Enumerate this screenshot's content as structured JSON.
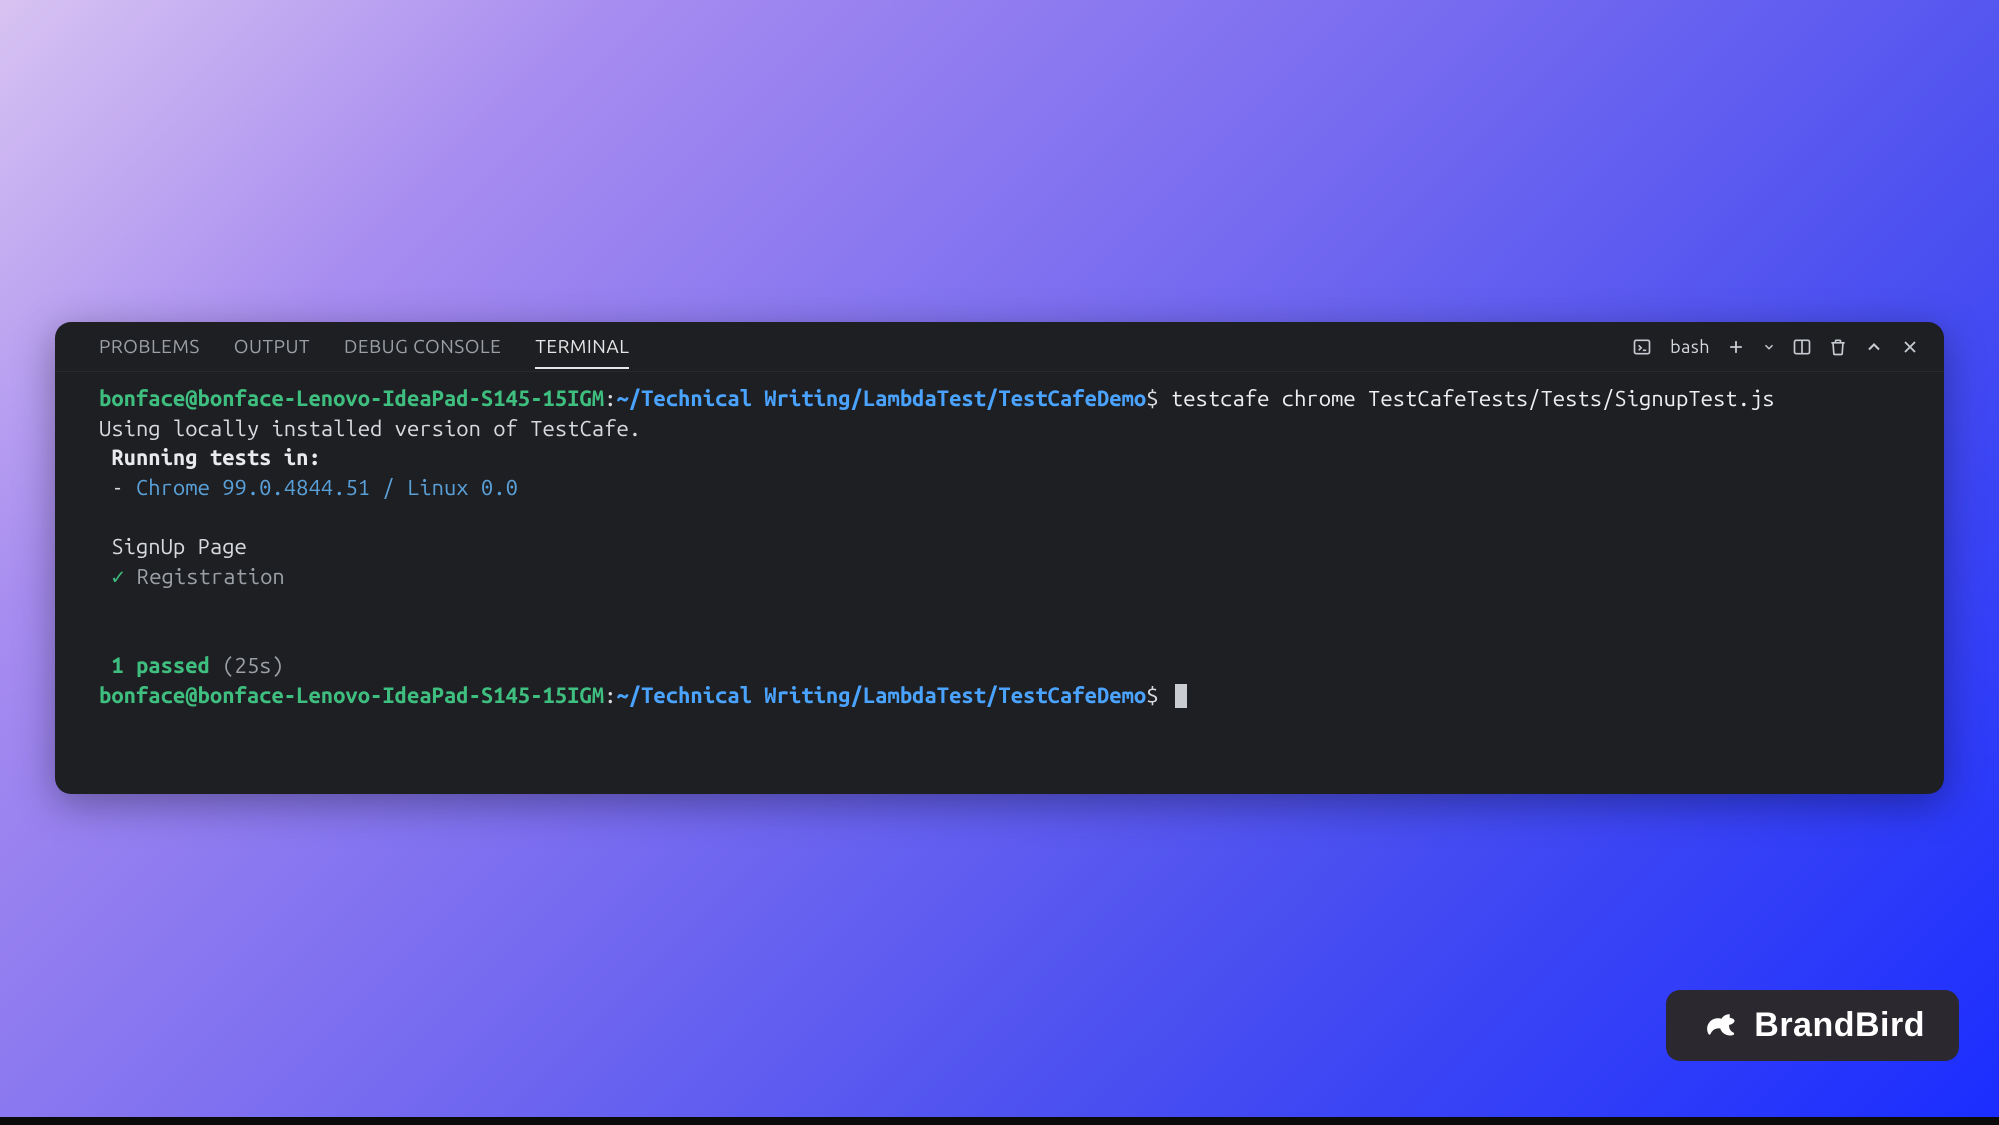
{
  "tabs": {
    "problems": "PROBLEMS",
    "output": "OUTPUT",
    "debug_console": "DEBUG CONSOLE",
    "terminal": "TERMINAL"
  },
  "toolbar": {
    "shell_label": "bash"
  },
  "terminal": {
    "prompt_user": "bonface@bonface-Lenovo-IdeaPad-S145-15IGM",
    "prompt_colon": ":",
    "prompt_path": "~/Technical Writing/LambdaTest/TestCafeDemo",
    "prompt_dollar": "$",
    "command": "testcafe chrome TestCafeTests/Tests/SignupTest.js",
    "line_using": "Using locally installed version of TestCafe.",
    "line_running": "Running tests in:",
    "line_browser_bullet": " - ",
    "line_browser": "Chrome 99.0.4844.51 / Linux 0.0",
    "fixture": "SignUp Page",
    "test_check": "✓",
    "test_name": "Registration",
    "result_passed": "1 passed",
    "result_time": "(25s)"
  },
  "watermark": {
    "label": "BrandBird"
  }
}
